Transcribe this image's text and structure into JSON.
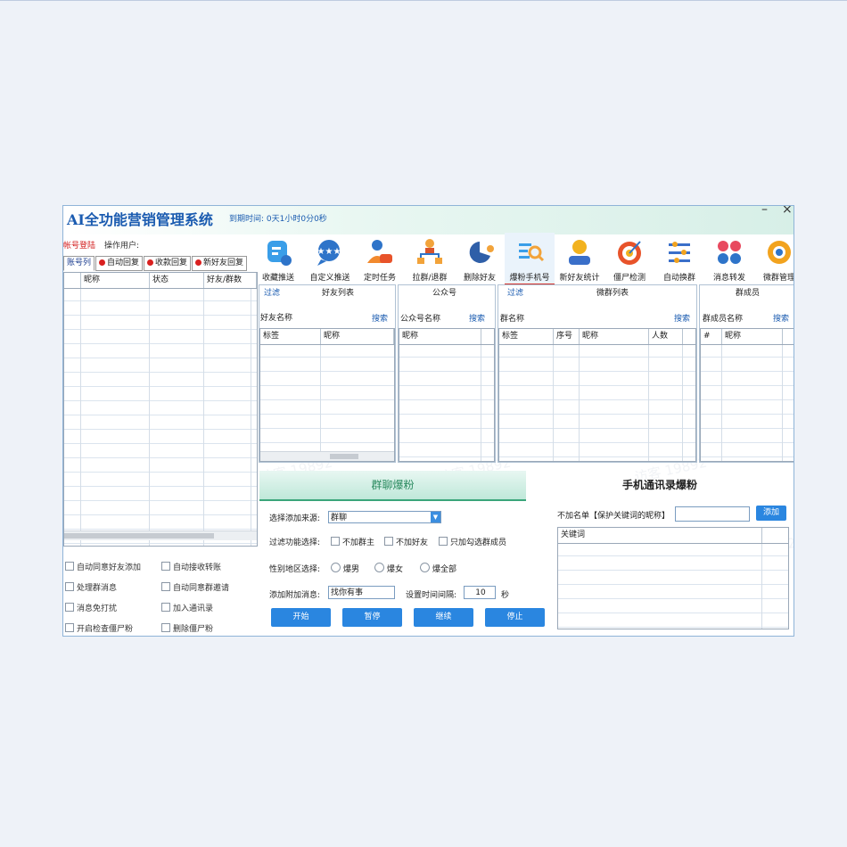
{
  "app": {
    "title": "AI全功能营销管理系统",
    "expire": "到期时间: 0天1小时0分0秒",
    "min": "–",
    "close": "×"
  },
  "account": {
    "login": "帐号登陆",
    "operator": "操作用户:"
  },
  "tabs": [
    {
      "label": "账号列"
    },
    {
      "label": "自动回复"
    },
    {
      "label": "收款回复"
    },
    {
      "label": "新好友回复"
    }
  ],
  "account_table": {
    "columns": [
      "",
      "昵称",
      "状态",
      "好友/群数"
    ]
  },
  "left_options": [
    "自动同意好友添加",
    "自动接收转账",
    "处理群消息",
    "自动同意群邀请",
    "消息免打扰",
    "加入通讯录",
    "开启检查僵尸粉",
    "删除僵尸粉"
  ],
  "toolbar": [
    {
      "label": "收藏推送",
      "icon": "favorites-push-icon",
      "color": "#3a9ee8"
    },
    {
      "label": "自定义推送",
      "icon": "custom-push-icon",
      "color": "#2e74c9"
    },
    {
      "label": "定时任务",
      "icon": "scheduled-task-icon",
      "color": "#f28a2e"
    },
    {
      "label": "拉群/退群",
      "icon": "group-join-icon",
      "color": "#f2a33a"
    },
    {
      "label": "删除好友",
      "icon": "delete-friend-icon",
      "color": "#2f5fa8"
    },
    {
      "label": "爆粉手机号",
      "icon": "phone-fans-icon",
      "color": "#3a9ee8"
    },
    {
      "label": "新好友统计",
      "icon": "new-friend-stats-icon",
      "color": "#f2b21e"
    },
    {
      "label": "僵尸检测",
      "icon": "zombie-detect-icon",
      "color": "#e8532a"
    },
    {
      "label": "自动换群",
      "icon": "auto-switch-group-icon",
      "color": "#3a6fc9"
    },
    {
      "label": "消息转发",
      "icon": "message-forward-icon",
      "color": "#e84a5f"
    },
    {
      "label": "微群管理",
      "icon": "group-manage-icon",
      "color": "#f2a31e"
    }
  ],
  "panels": {
    "friends": {
      "filter": "过滤",
      "title": "好友列表",
      "search_label": "好友名称",
      "search": "搜索",
      "columns": [
        "标签",
        "昵称"
      ]
    },
    "official": {
      "title": "公众号",
      "search_label": "公众号名称",
      "search": "搜索",
      "columns": [
        "昵称"
      ]
    },
    "groups": {
      "filter": "过滤",
      "title": "微群列表",
      "search_label": "群名称",
      "search": "搜索",
      "columns": [
        "标签",
        "序号",
        "昵称",
        "人数"
      ]
    },
    "members": {
      "title": "群成员",
      "search_label": "群成员名称",
      "search": "搜索",
      "columns": [
        "#",
        "昵称"
      ]
    }
  },
  "group_fans": {
    "banner": "群聊爆粉",
    "source_label": "选择添加来源:",
    "source_value": "群聊",
    "filter_label": "过滤功能选择:",
    "filter_options": [
      "不加群主",
      "不加好友",
      "只加勾选群成员"
    ],
    "gender_label": "性别地区选择:",
    "gender_options": [
      "爆男",
      "爆女",
      "爆全部"
    ],
    "message_label": "添加附加消息:",
    "message_value": "找你有事",
    "interval_label": "设置时间间隔:",
    "interval_value": "10",
    "interval_unit": "秒",
    "buttons": [
      "开始",
      "暂停",
      "继续",
      "停止"
    ]
  },
  "contacts_fans": {
    "banner": "手机通讯录爆粉",
    "exclude_label": "不加名单【保护关键词的昵称】",
    "add_button": "添加",
    "keyword_header": "关键词"
  },
  "watermark": "访客 19892"
}
